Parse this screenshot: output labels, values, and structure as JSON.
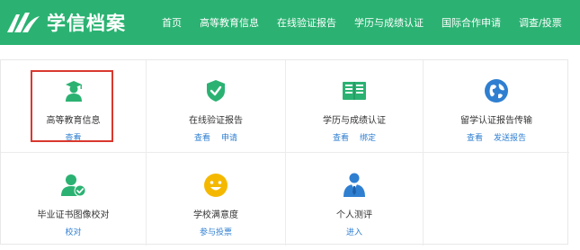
{
  "header": {
    "logo_text": "学信档案",
    "nav": [
      "首页",
      "高等教育信息",
      "在线验证报告",
      "学历与成绩认证",
      "国际合作申请",
      "调查/投票"
    ]
  },
  "services": [
    {
      "title": "高等教育信息",
      "links": [
        "查看"
      ],
      "icon": "graduate-user-icon",
      "color": "#2bb272"
    },
    {
      "title": "在线验证报告",
      "links": [
        "查看",
        "申请"
      ],
      "icon": "shield-check-icon",
      "color": "#2bb272"
    },
    {
      "title": "学历与成绩认证",
      "links": [
        "查看",
        "绑定"
      ],
      "icon": "open-book-icon",
      "color": "#2bb272"
    },
    {
      "title": "留学认证报告传输",
      "links": [
        "查看",
        "发送报告"
      ],
      "icon": "globe-icon",
      "color": "#2f7fd1"
    },
    {
      "title": "毕业证书图像校对",
      "links": [
        "校对"
      ],
      "icon": "user-check-icon",
      "color": "#2bb272"
    },
    {
      "title": "学校满意度",
      "links": [
        "参与投票"
      ],
      "icon": "smile-icon",
      "color": "#f5b800"
    },
    {
      "title": "个人测评",
      "links": [
        "进入"
      ],
      "icon": "person-tie-icon",
      "color": "#2f7fd1"
    }
  ],
  "colors": {
    "brand": "#2bb272",
    "link": "#2f7fd1",
    "highlight": "#d9382f"
  }
}
